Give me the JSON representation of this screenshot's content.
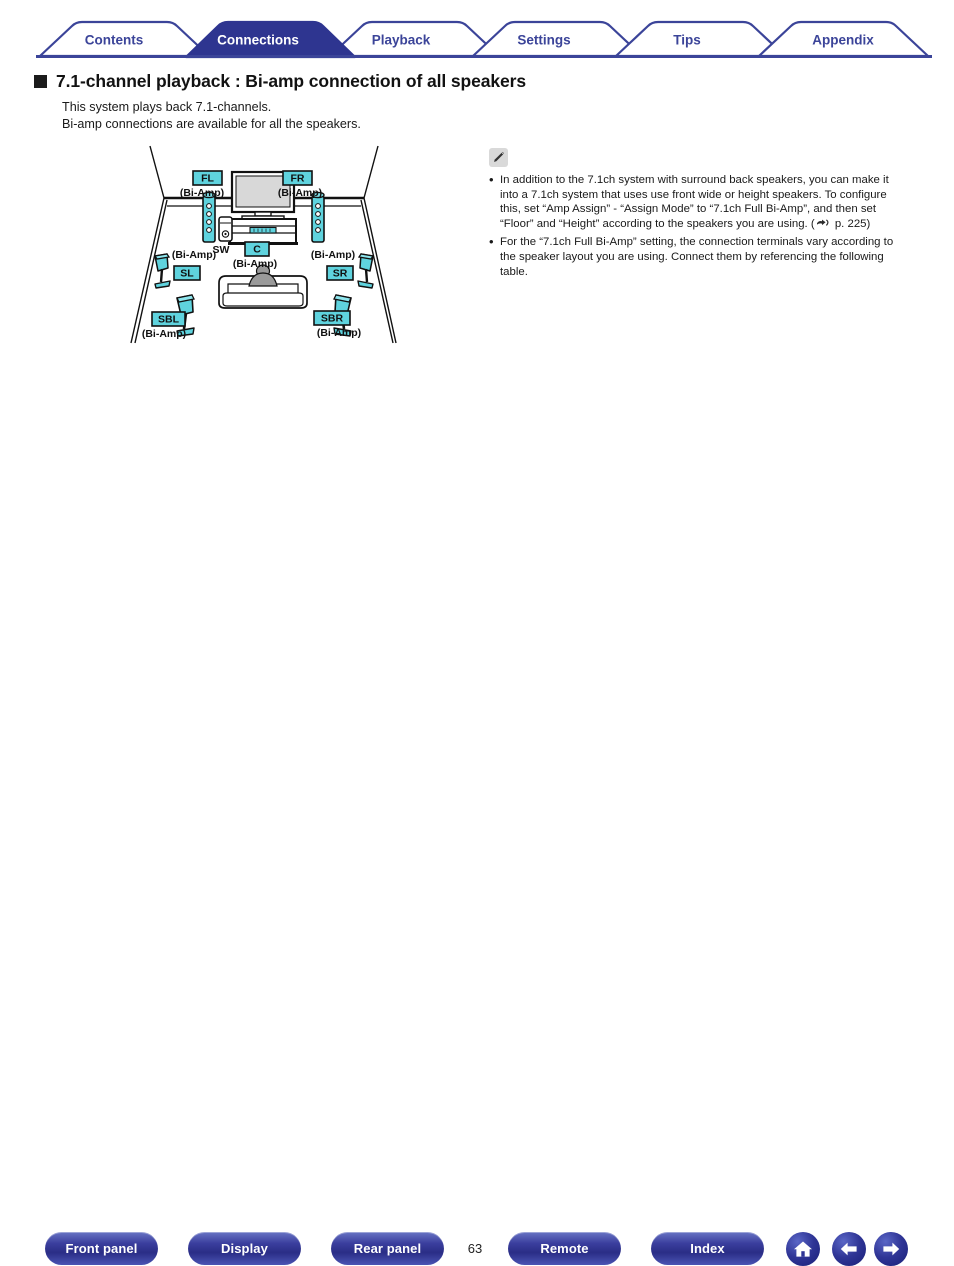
{
  "tabs": [
    {
      "label": "Contents",
      "active": false
    },
    {
      "label": "Connections",
      "active": true
    },
    {
      "label": "Playback",
      "active": false
    },
    {
      "label": "Settings",
      "active": false
    },
    {
      "label": "Tips",
      "active": false
    },
    {
      "label": "Appendix",
      "active": false
    }
  ],
  "heading": {
    "title": "7.1-channel playback : Bi-amp connection of all speakers"
  },
  "intro": {
    "line1": "This system plays back 7.1-channels.",
    "line2": "Bi-amp connections are available for all the speakers."
  },
  "diagram": {
    "labels": {
      "fl": "FL",
      "fl_sub": "(Bi-Amp)",
      "fr": "FR",
      "fr_sub": "(Bi-Amp)",
      "c": "C",
      "c_sub": "(Bi-Amp)",
      "sw": "SW",
      "sl": "SL",
      "sl_sub": "(Bi-Amp)",
      "sr": "SR",
      "sr_sub": "(Bi-Amp)",
      "sbl": "SBL",
      "sbl_sub": "(Bi-Amp)",
      "sbr": "SBR",
      "sbr_sub": "(Bi-Amp)"
    },
    "colors": {
      "speaker": "#5fd3de",
      "chip": "#5fd3de",
      "outline": "#111111"
    }
  },
  "note": {
    "items": [
      "In addition to the 7.1ch system with surround back speakers, you can make it into a 7.1ch system that uses use front wide or height speakers. To configure this, set “Amp Assign” - “Assign Mode” to “7.1ch Full Bi-Amp”, and then set “Floor” and “Height” according to the speakers you are using.  (",
      "For the “7.1ch Full Bi-Amp” setting, the connection terminals vary according to the speaker layout you are using. Connect them by referencing the following table."
    ],
    "page_ref": " p. 225)"
  },
  "footer": {
    "buttons": [
      {
        "label": "Front panel"
      },
      {
        "label": "Display"
      },
      {
        "label": "Rear panel"
      },
      {
        "label": "Remote"
      },
      {
        "label": "Index"
      }
    ],
    "page_number": "63",
    "icons": [
      {
        "name": "home-icon"
      },
      {
        "name": "back-arrow-icon"
      },
      {
        "name": "forward-arrow-icon"
      }
    ]
  },
  "colors": {
    "brand_blue": "#3b4499",
    "active_tab": "#2e3590",
    "speaker_cyan": "#5fd3de"
  }
}
